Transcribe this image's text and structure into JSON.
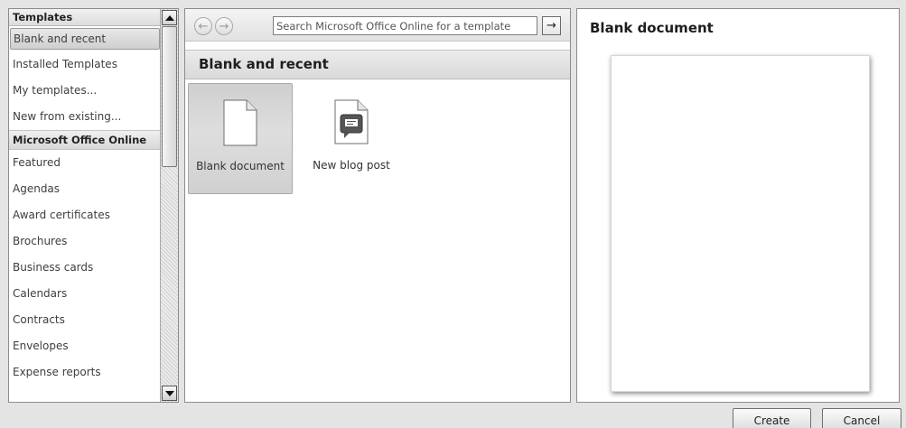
{
  "sidebar": {
    "header": "Templates",
    "items": [
      {
        "label": "Blank and recent"
      },
      {
        "label": "Installed Templates"
      },
      {
        "label": "My templates..."
      },
      {
        "label": "New from existing..."
      },
      {
        "label": "Microsoft Office Online"
      },
      {
        "label": "Featured"
      },
      {
        "label": "Agendas"
      },
      {
        "label": "Award certificates"
      },
      {
        "label": "Brochures"
      },
      {
        "label": "Business cards"
      },
      {
        "label": "Calendars"
      },
      {
        "label": "Contracts"
      },
      {
        "label": "Envelopes"
      },
      {
        "label": "Expense reports"
      }
    ],
    "selected": "Blank and recent"
  },
  "toolbar": {
    "back_icon": "back-arrow-icon",
    "forward_icon": "forward-arrow-icon",
    "search": {
      "placeholder": "Search Microsoft Office Online for a template",
      "value": ""
    },
    "go_icon": "go-arrow-icon"
  },
  "middle": {
    "section_title": "Blank and recent",
    "tiles": [
      {
        "label": "Blank document",
        "icon": "blank-document-icon",
        "selected": true
      },
      {
        "label": "New blog post",
        "icon": "blog-post-icon",
        "selected": false
      }
    ]
  },
  "preview": {
    "title": "Blank document"
  },
  "buttons": {
    "create": "Create",
    "cancel": "Cancel"
  },
  "colors": {
    "background": "#e4e4e4",
    "panel": "#ffffff",
    "selection": "#cfcfcf",
    "border": "#8c8c8c"
  }
}
